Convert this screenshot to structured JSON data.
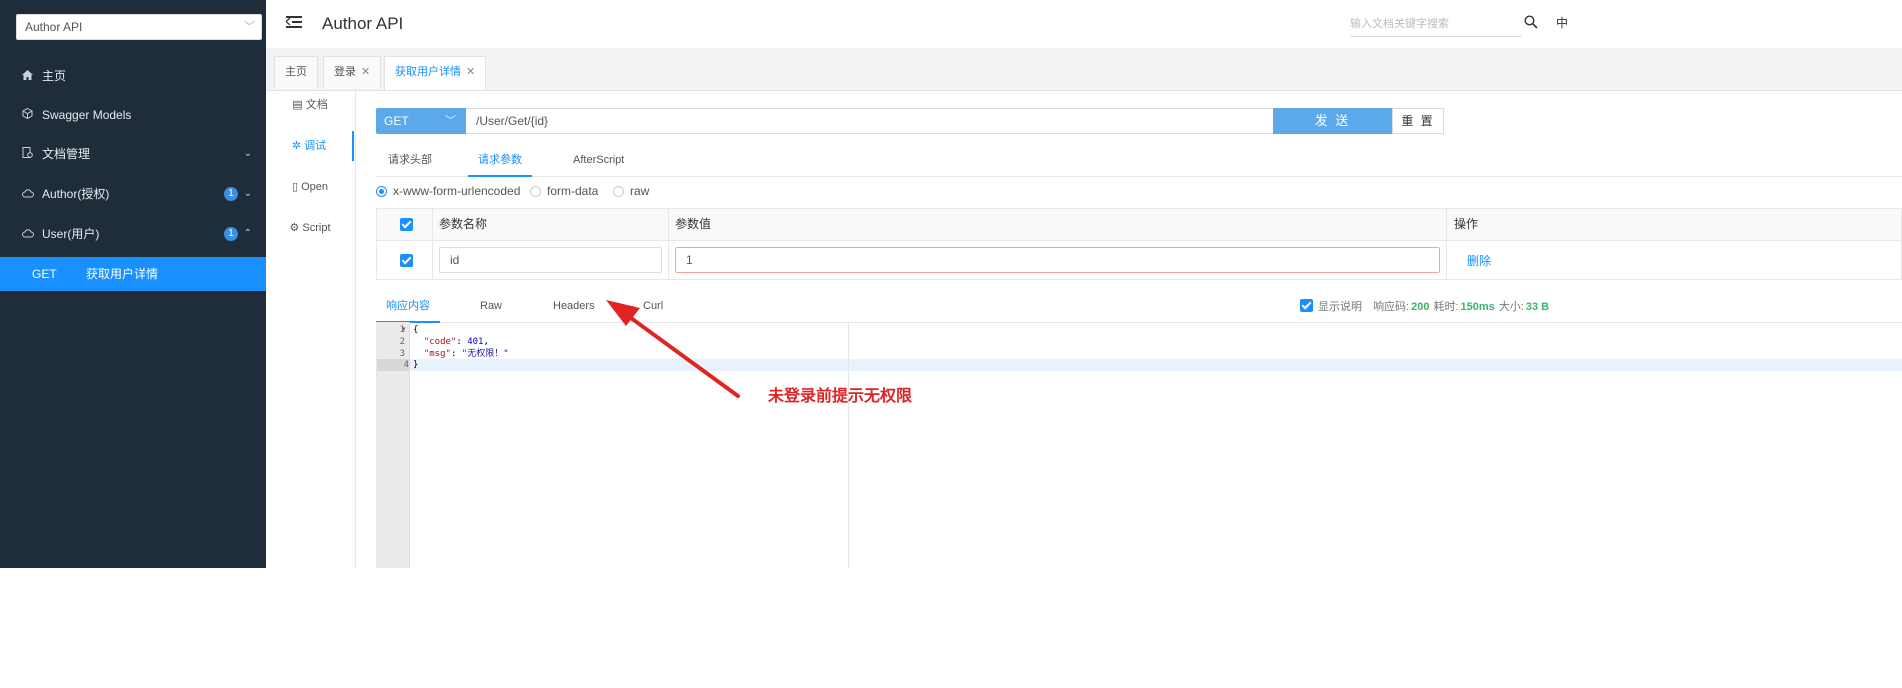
{
  "sidebar": {
    "api_select": "Author API",
    "items": [
      {
        "label": "主页",
        "icon": "home-icon"
      },
      {
        "label": "Swagger Models",
        "icon": "cube-icon"
      },
      {
        "label": "文档管理",
        "icon": "document-manage-icon"
      },
      {
        "label": "Author(授权)",
        "icon": "cloud-icon",
        "badge": "1"
      },
      {
        "label": "User(用户)",
        "icon": "cloud-icon",
        "badge": "1"
      }
    ],
    "subitem": {
      "method": "GET",
      "label": "获取用户详情"
    }
  },
  "header": {
    "title": "Author API",
    "search_placeholder": "输入文档关键字搜索",
    "lang": "中"
  },
  "tabs": [
    {
      "label": "主页"
    },
    {
      "label": "登录"
    },
    {
      "label": "获取用户详情"
    }
  ],
  "doc_menu": [
    {
      "label": "文档"
    },
    {
      "label": "调试"
    },
    {
      "label": "Open"
    },
    {
      "label": "Script"
    }
  ],
  "request": {
    "method": "GET",
    "url": "/User/Get/{id}",
    "send_label": "发 送",
    "reset_label": "重 置"
  },
  "request_tabs": [
    "请求头部",
    "请求参数",
    "AfterScript"
  ],
  "content_types": [
    "x-www-form-urlencoded",
    "form-data",
    "raw"
  ],
  "params": {
    "headers": {
      "name": "参数名称",
      "value": "参数值",
      "op": "操作"
    },
    "rows": [
      {
        "name": "id",
        "value": "1",
        "action": "删除"
      }
    ]
  },
  "response_tabs": [
    "响应内容",
    "Raw",
    "Headers",
    "Curl"
  ],
  "response_info": {
    "show_desc": "显示说明",
    "code_label": "响应码:",
    "code": "200",
    "time_label": "耗时:",
    "time": "150ms",
    "size_label": "大小:",
    "size": "33 B"
  },
  "code_lines": [
    "1",
    "2",
    "3",
    "4"
  ],
  "code": {
    "open": "{",
    "code_key": "\"code\"",
    "code_val": "401",
    "msg_key": "\"msg\"",
    "msg_val": "\"无权限！\"",
    "close": "}"
  },
  "annotation": {
    "text": "未登录前提示无权限",
    "color": "#e02424"
  },
  "colors": {
    "sidebar_bg": "#1f2d3a",
    "accent": "#1890ff",
    "button": "#5ba8ea"
  }
}
